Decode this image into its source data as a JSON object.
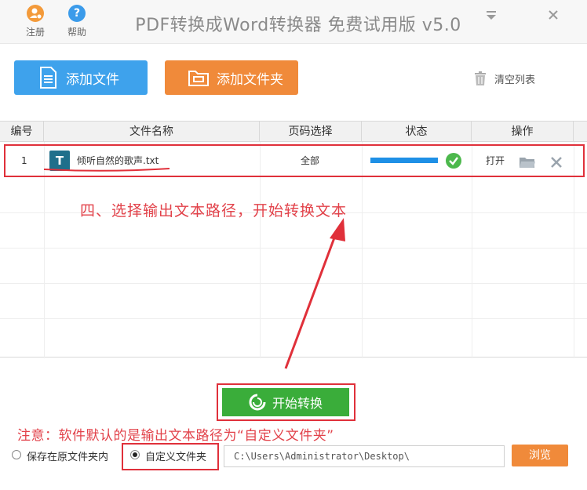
{
  "titlebar": {
    "register_label": "注册",
    "help_label": "帮助",
    "title": "PDF转换成Word转换器 免费试用版 v5.0"
  },
  "toolbar": {
    "add_file_label": "添加文件",
    "add_folder_label": "添加文件夹",
    "clear_list_label": "清空列表"
  },
  "table": {
    "columns": [
      "编号",
      "文件名称",
      "页码选择",
      "状态",
      "操作"
    ],
    "rows": [
      {
        "index": "1",
        "file_icon_letter": "T",
        "filename": "倾听自然的歌声.txt",
        "pages": "全部",
        "progress": 1.0,
        "status_icon": "check-circle-icon",
        "open_label": "打开"
      }
    ]
  },
  "annotations": {
    "step_text": "四、选择输出文本路径，开始转换文本",
    "note_text": "注意：软件默认的是输出文本路径为“自定义文件夹”"
  },
  "actions": {
    "start_label": "开始转换"
  },
  "output": {
    "option_original_label": "保存在原文件夹内",
    "option_custom_label": "自定义文件夹",
    "selected_option": "custom",
    "path_value": "C:\\Users\\Administrator\\Desktop\\",
    "browse_label": "浏览"
  },
  "colors": {
    "blue_button": "#3ea2ec",
    "orange_button": "#f08a3a",
    "green_button": "#3aad3a",
    "annotation_red": "#e2424a"
  }
}
